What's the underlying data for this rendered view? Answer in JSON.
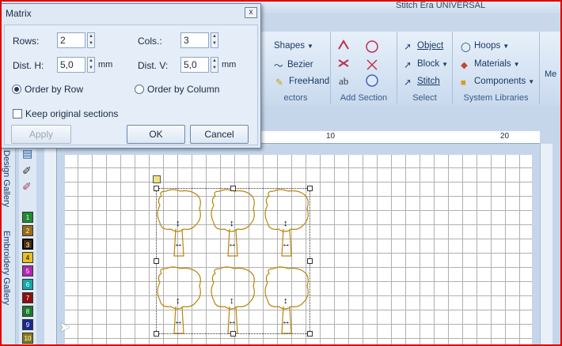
{
  "app": {
    "title": "Stitch Era UNIVERSAL"
  },
  "ribbon": {
    "vectors": {
      "items": [
        "Shapes",
        "Bezier",
        "FreeHand"
      ],
      "label_fragment": "ectors"
    },
    "add_section": {
      "label": "Add Section"
    },
    "select": {
      "items": [
        "Object",
        "Block",
        "Stitch"
      ],
      "label": "Select"
    },
    "system_libraries": {
      "items": [
        "Hoops",
        "Materials",
        "Components"
      ],
      "label": "System Libraries"
    },
    "cut_label": "Me"
  },
  "side": {
    "design_gallery": "Design Gallery",
    "embroidery_gallery": "Embroidery Gallery"
  },
  "swatches": [
    "1",
    "2",
    "3",
    "4",
    "5",
    "6",
    "7",
    "8",
    "9",
    "10"
  ],
  "ruler": {
    "ticks": [
      "10",
      "20"
    ]
  },
  "dialog": {
    "title": "Matrix",
    "close": "x",
    "rows_label": "Rows:",
    "rows_value": "2",
    "cols_label": "Cols.:",
    "cols_value": "3",
    "disth_label": "Dist. H:",
    "disth_value": "5,0",
    "disth_unit": "mm",
    "distv_label": "Dist. V:",
    "distv_value": "5,0",
    "distv_unit": "mm",
    "order_row": "Order by Row",
    "order_column": "Order by Column",
    "keep_sections": "Keep original sections",
    "apply": "Apply",
    "ok": "OK",
    "cancel": "Cancel"
  },
  "colors": {
    "border": "#e00000",
    "thread": "#b8860b"
  },
  "trees": [
    0,
    1,
    2,
    3,
    4,
    5
  ]
}
